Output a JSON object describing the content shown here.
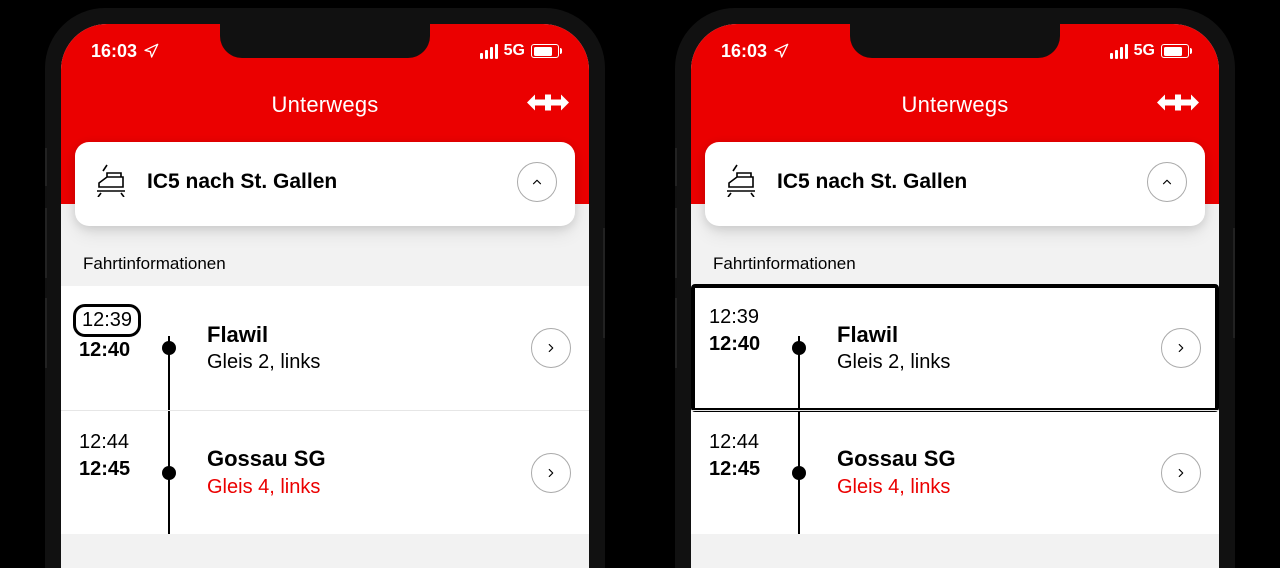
{
  "status": {
    "time": "16:03",
    "network": "5G"
  },
  "header": {
    "title": "Unterwegs"
  },
  "card": {
    "title": "IC5 nach St. Gallen"
  },
  "section": {
    "label": "Fahrtinformationen"
  },
  "stops": [
    {
      "arr": "12:39",
      "dep": "12:40",
      "name": "Flawil",
      "platform": "Gleis 2, links",
      "alert": false
    },
    {
      "arr": "12:44",
      "dep": "12:45",
      "name": "Gossau SG",
      "platform": "Gleis 4, links",
      "alert": true
    }
  ]
}
